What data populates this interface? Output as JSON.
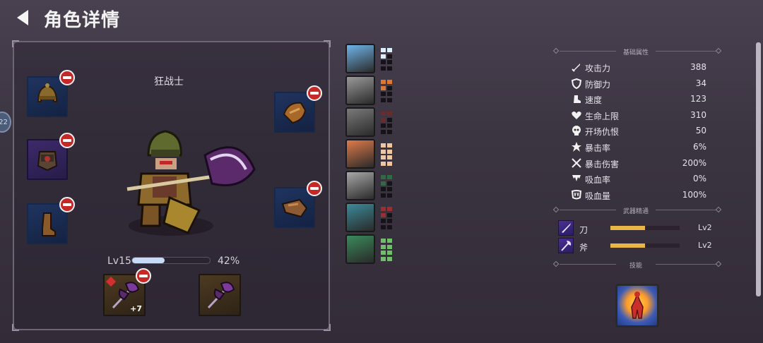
{
  "header": {
    "title": "角色详情",
    "back_icon": "back-arrow-icon"
  },
  "side_tab": {
    "label": "22"
  },
  "character": {
    "name": "狂战士",
    "level_label": "Lv15",
    "exp_percent_label": "42%",
    "exp_progress": 0.42
  },
  "equipment": {
    "left_slots": [
      {
        "icon": "helmet-icon",
        "removable": true
      },
      {
        "icon": "armor-icon",
        "removable": true
      },
      {
        "icon": "boots-icon",
        "removable": true
      }
    ],
    "right_slots": [
      {
        "icon": "shoulder-guard-icon",
        "removable": true
      },
      {
        "icon": "gauntlet-icon",
        "removable": true
      }
    ],
    "weapons": [
      {
        "icon": "battle-axe-icon",
        "enhance": "+7",
        "removable": true
      },
      {
        "icon": "battle-axe-icon",
        "enhance": "",
        "removable": false
      }
    ]
  },
  "portraits": [
    {
      "icon": "winged-emblem-icon",
      "pip_color": "#dcefff"
    },
    {
      "icon": "skeleton-portrait-icon",
      "pip_color": "#e0772e"
    },
    {
      "icon": "demon-portrait-icon",
      "pip_color": "#6b2b2b"
    },
    {
      "icon": "fire-creature-portrait-icon",
      "pip_color": "#f0c6a0"
    },
    {
      "icon": "ghost-portrait-icon",
      "pip_color": "#2e6b43"
    },
    {
      "icon": "warrior-portrait-icon",
      "pip_color": "#9b2f2f"
    },
    {
      "icon": "elf-portrait-icon",
      "pip_color": "#6fbf6a"
    }
  ],
  "stats": {
    "section_title": "基础属性",
    "rows": [
      {
        "icon": "sword-icon",
        "label": "攻击力",
        "value": "388"
      },
      {
        "icon": "shield-icon",
        "label": "防御力",
        "value": "34"
      },
      {
        "icon": "boot-speed-icon",
        "label": "速度",
        "value": "123"
      },
      {
        "icon": "heart-icon",
        "label": "生命上限",
        "value": "310"
      },
      {
        "icon": "skull-icon",
        "label": "开场仇恨",
        "value": "50"
      },
      {
        "icon": "crit-burst-icon",
        "label": "暴击率",
        "value": "6%"
      },
      {
        "icon": "crossed-swords-icon",
        "label": "暴击伤害",
        "value": "200%"
      },
      {
        "icon": "fang-drip-icon",
        "label": "吸血率",
        "value": "0%"
      },
      {
        "icon": "fangs-icon",
        "label": "吸血量",
        "value": "100%"
      }
    ]
  },
  "mastery": {
    "section_title": "武器精通",
    "rows": [
      {
        "icon": "blade-icon",
        "label": "刀",
        "level": "Lv2",
        "progress": 0.5
      },
      {
        "icon": "axe-icon",
        "label": "斧",
        "level": "Lv2",
        "progress": 0.5
      }
    ]
  },
  "skills": {
    "section_title": "技能",
    "icon": "rage-aura-skill-icon"
  },
  "colors": {
    "accent": "#e9b545",
    "danger": "#c62828",
    "exp": "#c6dbf5"
  }
}
